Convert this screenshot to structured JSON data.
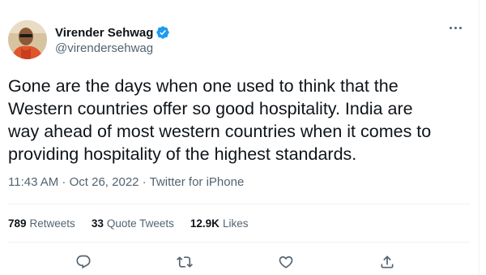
{
  "user": {
    "display_name": "Virender Sehwag",
    "handle": "@virendersehwag",
    "verified": true,
    "avatar_icon": "profile-photo"
  },
  "tweet": {
    "text": "Gone are the days when one used to think that the\nWestern countries offer so good hospitality. India are\nway ahead of most western countries when it comes to\nproviding hospitality of the highest standards.",
    "time": "11:43 AM",
    "date": "Oct 26, 2022",
    "source": "Twitter for iPhone",
    "separator": " · "
  },
  "stats": {
    "retweets_count": "789",
    "retweets_label": "Retweets",
    "quotes_count": "33",
    "quotes_label": "Quote Tweets",
    "likes_count": "12.9K",
    "likes_label": "Likes"
  },
  "actions": [
    {
      "name": "reply",
      "icon": "reply-icon"
    },
    {
      "name": "retweet",
      "icon": "retweet-icon"
    },
    {
      "name": "like",
      "icon": "heart-icon"
    },
    {
      "name": "share",
      "icon": "share-icon"
    }
  ],
  "colors": {
    "text": "#0f1419",
    "secondary": "#536471",
    "verified": "#1d9bf0",
    "divider": "#eff3f4"
  }
}
